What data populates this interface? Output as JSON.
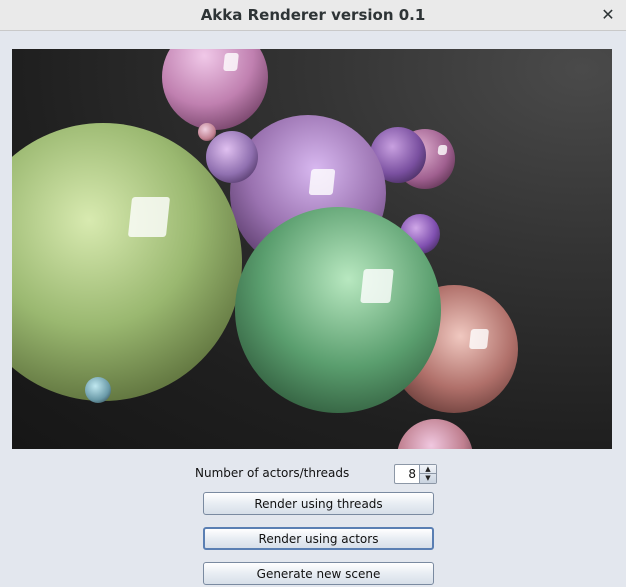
{
  "window": {
    "title": "Akka Renderer version 0.1",
    "close_glyph": "✕"
  },
  "controls": {
    "threads_label": "Number of actors/threads",
    "threads_value": "8",
    "spin_up_glyph": "▲",
    "spin_down_glyph": "▼",
    "render_threads_label": "Render using threads",
    "render_actors_label": "Render using actors",
    "generate_scene_label": "Generate new scene"
  },
  "colors": {
    "background": "#e3e7ee",
    "sphere_green": "#8fb060",
    "sphere_teal": "#5a9e6e",
    "sphere_purple": "#9a72b0",
    "sphere_pink": "#c080a8",
    "sphere_salmon": "#b0706a"
  }
}
